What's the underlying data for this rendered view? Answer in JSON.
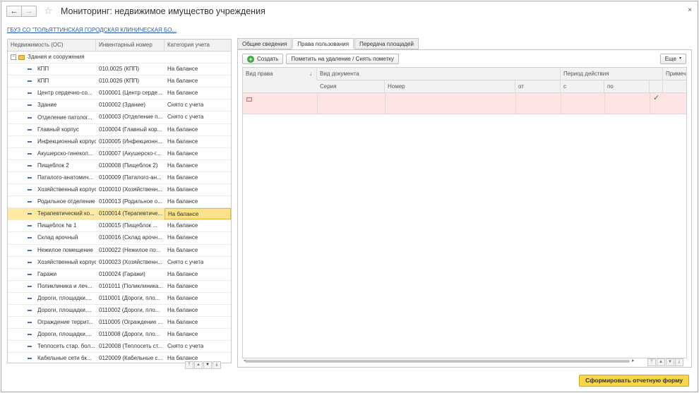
{
  "window": {
    "title": "Мониторинг: недвижимое имущество учреждения",
    "close": "×"
  },
  "nav": {
    "back": "←",
    "forward": "→",
    "favorite": "☆"
  },
  "org_link": "ГБУЗ СО \"ТОЛЬЯТТИНСКАЯ ГОРОДСКАЯ КЛИНИЧЕСКАЯ БО...",
  "left_table": {
    "columns": [
      "Недвижимость (ОС)",
      "Инвентарный номер",
      "Категория учета"
    ],
    "group": "Здания и сооружения",
    "rows": [
      [
        "КПП",
        "010.0025 (КПП)",
        "На балансе"
      ],
      [
        "КПП",
        "010.0026 (КПП)",
        "На балансе"
      ],
      [
        "Центр сердечно-со...",
        "0100001 (Центр серде...",
        "На балансе"
      ],
      [
        "Здание",
        "0100002 (Здание)",
        "Снято с учета"
      ],
      [
        "Отделение патолог...",
        "0100003 (Отделение п...",
        "Снято с учета"
      ],
      [
        "Главный корпус",
        "0100004 (Главный кор...",
        "На балансе"
      ],
      [
        "Инфекционный корпус",
        "0100005 (Инфекционн...",
        "На балансе"
      ],
      [
        "Акушерско-гинекол...",
        "0100007 (Акушерско-г...",
        "На балансе"
      ],
      [
        "Пищеблок 2",
        "0100008 (Пищеблок 2)",
        "На балансе"
      ],
      [
        "Паталого-анатомич...",
        "0100009 (Паталого-ан...",
        "На балансе"
      ],
      [
        "Хозяйственный корпус",
        "0100010 (Хозяйственн...",
        "На балансе"
      ],
      [
        "Родильное отделение",
        "0100013 (Родильное о...",
        "На балансе"
      ],
      [
        "Терапевтический ко...",
        "0100014 (Терапевтиче...",
        "На балансе"
      ],
      [
        "Пищеблок № 1",
        "0100015 (Пищеблок ...",
        "На балансе"
      ],
      [
        "Склад арочный",
        "0100016 (Склад арочн...",
        "На балансе"
      ],
      [
        "Нежилое помещение",
        "0100022 (Нежилое по...",
        "На балансе"
      ],
      [
        "Хозяйственный корпус",
        "0100023 (Хозяйственн...",
        "Снято с учета"
      ],
      [
        "Гаражи",
        "0100024 (Гаражи)",
        "На балансе"
      ],
      [
        "Поликлиника и леч...",
        "0101011 (Поликлиника...",
        "На балансе"
      ],
      [
        "Дороги, площадки,...",
        "0110001 (Дороги, пло...",
        "На балансе"
      ],
      [
        "Дороги, площадки,...",
        "0110002 (Дороги, пло...",
        "На балансе"
      ],
      [
        "Ограждение террит...",
        "0110005 (Ограждение ...",
        "На балансе"
      ],
      [
        "Дороги, площадки,...",
        "0110008 (Дороги, пло...",
        "На балансе"
      ],
      [
        "Теплосеть стар. бол...",
        "0120008 (Теплосеть ст...",
        "Снято с учета"
      ],
      [
        "Кабельные сети 6к...",
        "0120009 (Кабельные с...",
        "На балансе"
      ]
    ],
    "selected_index": 12
  },
  "tabs": [
    "Общие сведения",
    "Права пользования",
    "Передача площадей"
  ],
  "toolbar": {
    "create": "Создать",
    "mark_delete": "Пометить на удаление / Снять пометку",
    "more": "Еще"
  },
  "grid": {
    "header1": {
      "right_type": "Вид права",
      "doc_type": "Вид документа",
      "period": "Период действия",
      "note": "Примеч"
    },
    "header2": {
      "series": "Серия",
      "number": "Номер",
      "date_from": "от",
      "from": "с",
      "to": "по"
    },
    "sort_icon": "↓",
    "check": "✓"
  },
  "report_button": "Сформировать отчетную форму"
}
